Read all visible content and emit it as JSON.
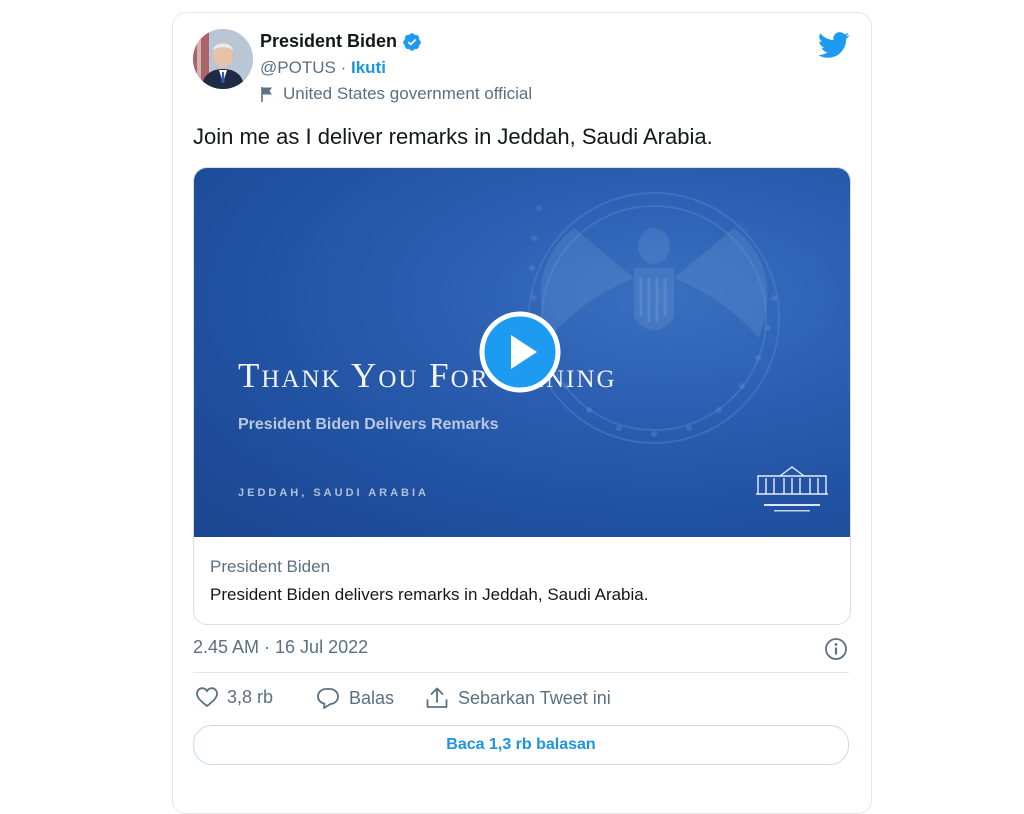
{
  "author": {
    "name": "President Biden",
    "handle": "@POTUS",
    "separator": "·",
    "follow_label": "Ikuti",
    "label": "United States government official",
    "avatar_icon": "person-avatar",
    "verified_icon": "verified-badge-icon"
  },
  "tweet": {
    "text": "Join me as I deliver remarks in Jeddah, Saudi Arabia."
  },
  "media": {
    "slide_title": "Thank You For Joining",
    "slide_subtitle": "President Biden Delivers Remarks",
    "slide_location": "JEDDAH, SAUDI ARABIA",
    "play_icon": "play-icon",
    "source": "President Biden",
    "description": "President Biden delivers remarks in Jeddah, Saudi Arabia."
  },
  "meta": {
    "timestamp": "2.45 AM · 16 Jul 2022"
  },
  "actions": {
    "like_count": "3,8 rb",
    "reply_label": "Balas",
    "share_label": "Sebarkan Tweet ini"
  },
  "replies_button": "Baca 1,3 rb balasan",
  "colors": {
    "accent": "#1b95e0",
    "verified": "#1d9bf0",
    "media_bg": "#1f4f9e"
  }
}
